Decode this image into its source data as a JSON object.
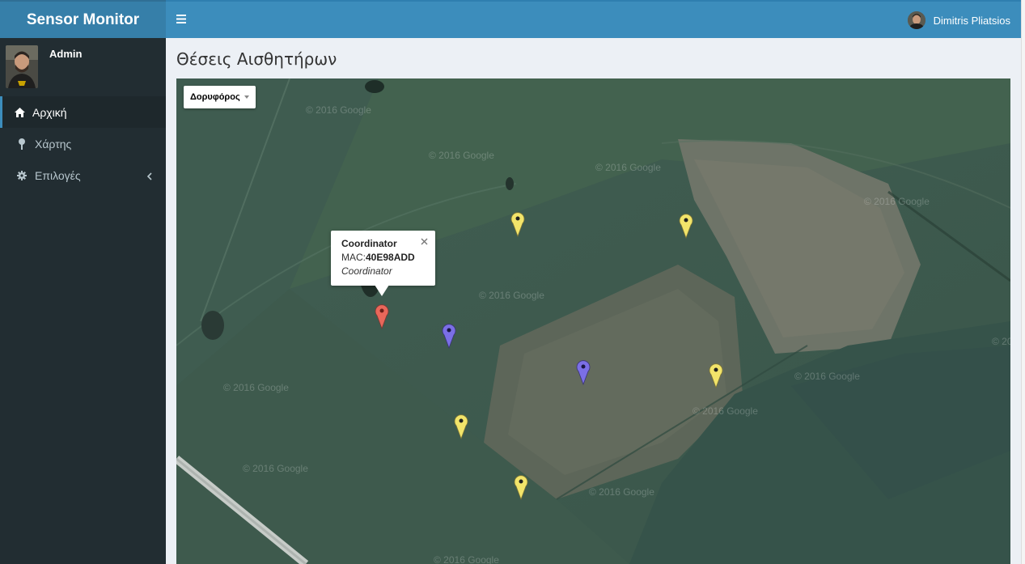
{
  "app": {
    "brand": "Sensor Monitor"
  },
  "sidebar": {
    "user": {
      "name": "Admin"
    },
    "items": [
      {
        "label": "Αρχική",
        "icon": "home-icon",
        "active": true
      },
      {
        "label": "Χάρτης",
        "icon": "map-pin-icon",
        "active": false
      },
      {
        "label": "Επιλογές",
        "icon": "gear-icon",
        "active": false,
        "expand_icon": "chevron-left-icon"
      }
    ]
  },
  "navbar": {
    "menu_icon": "hamburger-icon",
    "user_name": "Dimitris Pliatsios"
  },
  "page": {
    "title": "Θέσεις Αισθητήρων"
  },
  "map": {
    "type_label": "Δορυφόρος",
    "watermark": "© 2016 Google",
    "infowindow": {
      "title": "Coordinator",
      "mac_label": "MAC:",
      "mac_value": "40E98ADD",
      "type": "Coordinator"
    },
    "colors": {
      "coordinator": "#e8675a",
      "router": "#7b6fe6",
      "sensor": "#f2e46a"
    }
  }
}
